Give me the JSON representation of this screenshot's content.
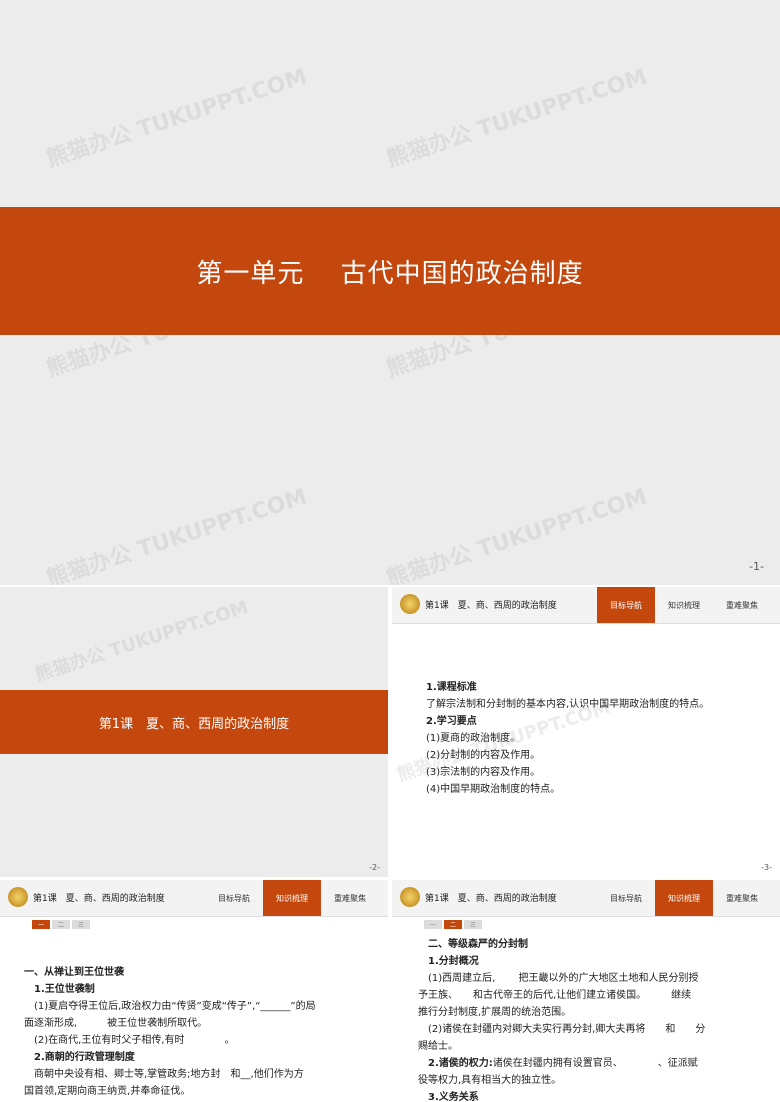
{
  "watermark": "熊猫办公 TUKUPPT.COM",
  "slide1": {
    "title": "第一单元　 古代中国的政治制度",
    "page": "-1-"
  },
  "slide2": {
    "title": "第1课　夏、商、西周的政治制度",
    "page": "-2-"
  },
  "header": {
    "title": "第1课　夏、商、西周的政治制度",
    "tabs": [
      "目标导航",
      "知识梳理",
      "重难聚焦"
    ]
  },
  "pager": [
    "一",
    "二",
    "三"
  ],
  "slide3": {
    "page": "-3-",
    "h1": "1.课程标准",
    "p1": "了解宗法制和分封制的基本内容,认识中国早期政治制度的特点。",
    "h2": "2.学习要点",
    "items": [
      "(1)夏商的政治制度。",
      "(2)分封制的内容及作用。",
      "(3)宗法制的内容及作用。",
      "(4)中国早期政治制度的特点。"
    ]
  },
  "slide4": {
    "section": "一、从禅让到王位世袭",
    "h1": "1.王位世袭制",
    "l1": "(1)夏启夺得王位后,政治权力由“传贤”变成“传子”,“______”的局",
    "l2": "面逐渐形成,　　　被王位世袭制所取代。",
    "l3": "(2)在商代,王位有时父子相传,有时　　　　。",
    "h2": "2.商朝的行政管理制度",
    "l4": "商朝中央设有相、卿士等,掌管政务;地方封　和__,他们作为方",
    "l5": "国首领,定期向商王纳贡,并奉命征伐。"
  },
  "slide5": {
    "section": "二、等级森严的分封制",
    "h1": "1.分封概况",
    "l1": "(1)西周建立后,　　 把王畿以外的广大地区土地和人民分别授",
    "l2": "予王族、　　和古代帝王的后代,让他们建立诸侯国。　　　继续",
    "l3": "推行分封制度,扩展周的统治范围。",
    "l4": "(2)诸侯在封疆内对卿大夫实行再分封,卿大夫再将　　和　　分",
    "l5": "赐给士。",
    "h2": "2.诸侯的权力:",
    "l6": "诸侯在封疆内拥有设置官员、　　　　、征派赋",
    "l7": "役等权力,具有相当大的独立性。",
    "h3": "3.义务关系"
  }
}
